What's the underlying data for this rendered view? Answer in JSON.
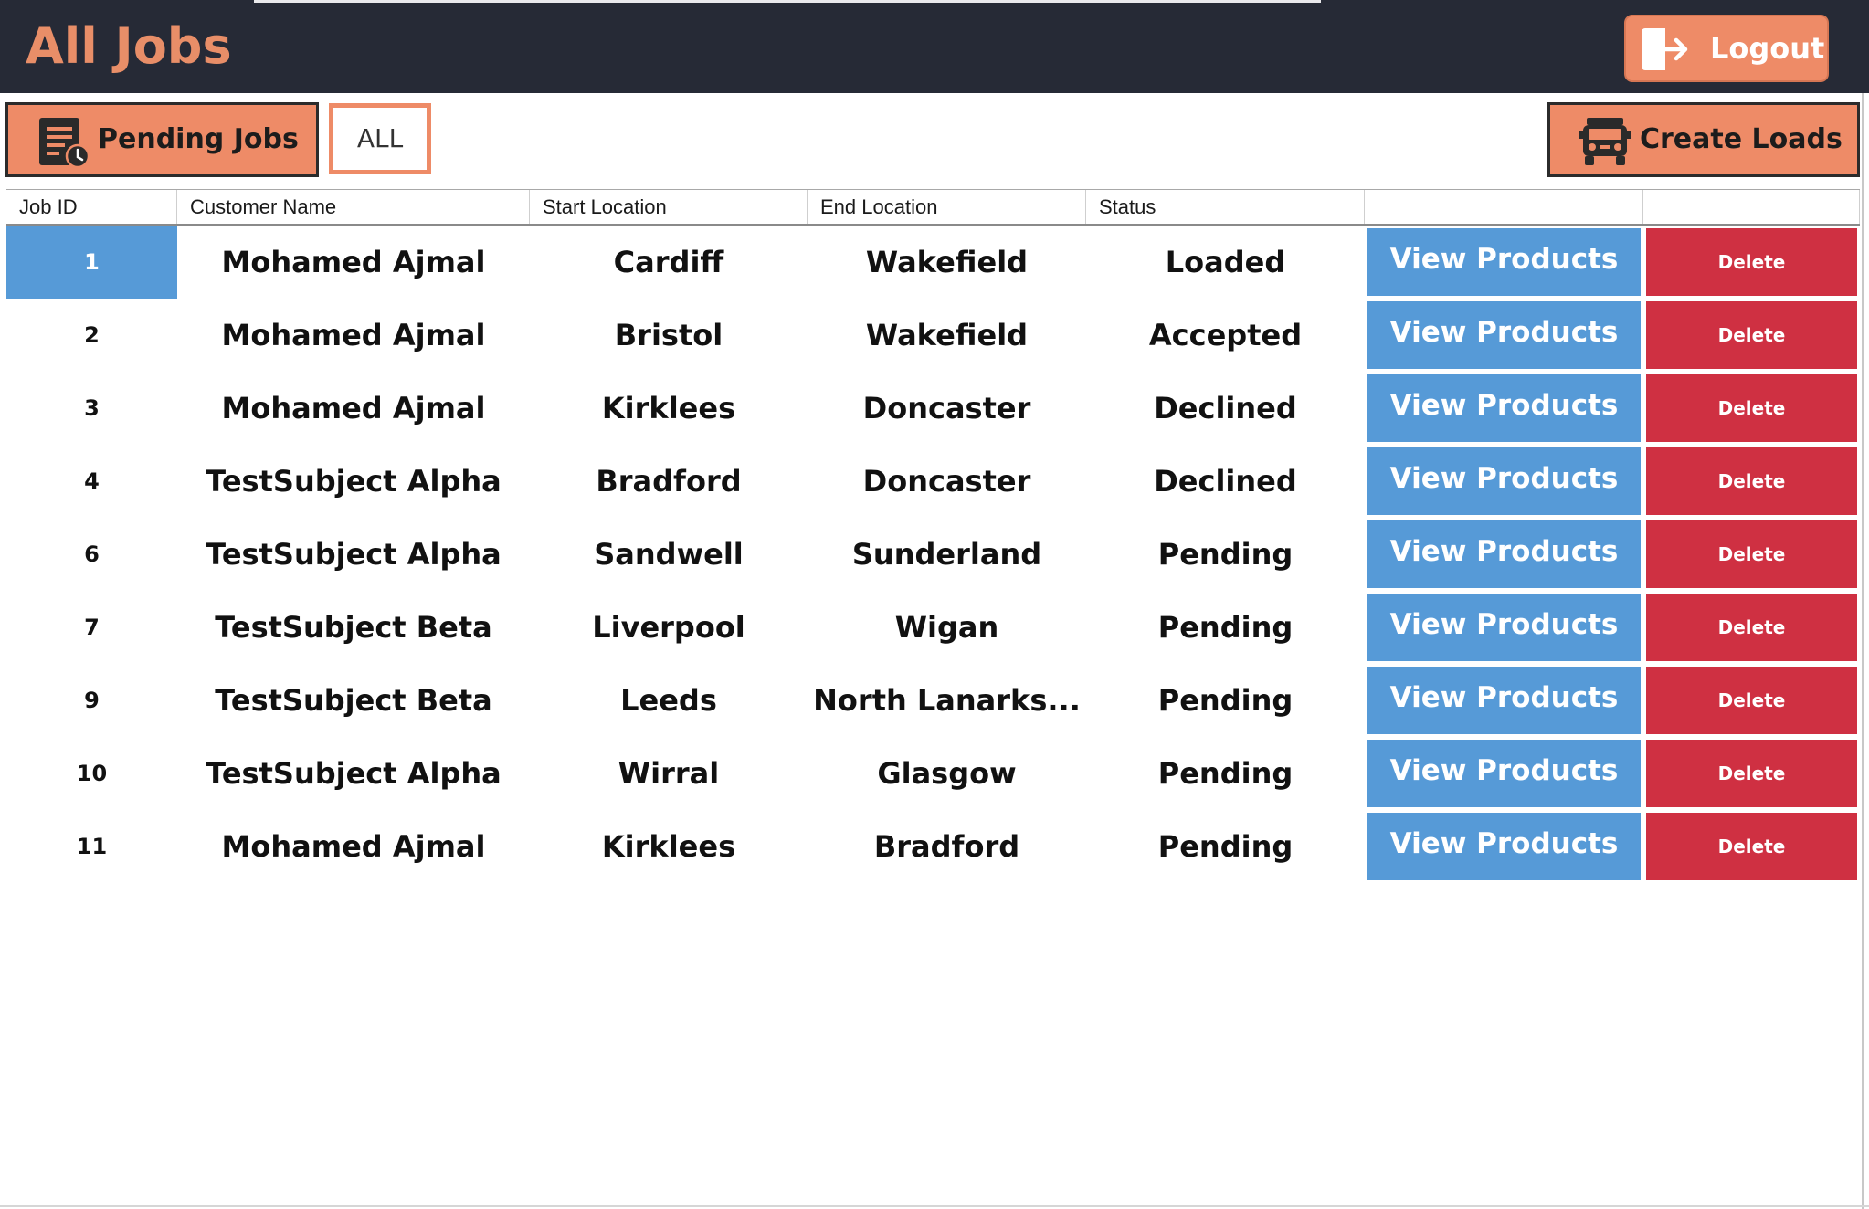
{
  "header": {
    "title": "All Jobs",
    "logout_label": "Logout",
    "logout_icon": "logout-icon",
    "background_color": "#262a36",
    "accent_color": "#ee8b67"
  },
  "toolbar": {
    "pending_label": "Pending Jobs",
    "pending_icon": "clipboard-clock-icon",
    "filter_value": "ALL",
    "create_loads_label": "Create Loads",
    "create_loads_icon": "truck-icon"
  },
  "table": {
    "columns": [
      "Job ID",
      "Customer Name",
      "Start Location",
      "End Location",
      "Status",
      "",
      ""
    ],
    "selected_row": 0,
    "view_color": "#569ad7",
    "delete_color": "#cf3042",
    "rows": [
      {
        "id": "1",
        "customer": "Mohamed Ajmal",
        "start": "Cardiff",
        "end": "Wakefield",
        "status": "Loaded",
        "view": "View Products",
        "delete": "Delete"
      },
      {
        "id": "2",
        "customer": "Mohamed Ajmal",
        "start": "Bristol",
        "end": "Wakefield",
        "status": "Accepted",
        "view": "View Products",
        "delete": "Delete"
      },
      {
        "id": "3",
        "customer": "Mohamed Ajmal",
        "start": "Kirklees",
        "end": "Doncaster",
        "status": "Declined",
        "view": "View Products",
        "delete": "Delete"
      },
      {
        "id": "4",
        "customer": "TestSubject Alpha",
        "start": "Bradford",
        "end": "Doncaster",
        "status": "Declined",
        "view": "View Products",
        "delete": "Delete"
      },
      {
        "id": "6",
        "customer": "TestSubject Alpha",
        "start": "Sandwell",
        "end": "Sunderland",
        "status": "Pending",
        "view": "View Products",
        "delete": "Delete"
      },
      {
        "id": "7",
        "customer": "TestSubject Beta",
        "start": "Liverpool",
        "end": "Wigan",
        "status": "Pending",
        "view": "View Products",
        "delete": "Delete"
      },
      {
        "id": "9",
        "customer": "TestSubject Beta",
        "start": "Leeds",
        "end": "North Lanarks...",
        "status": "Pending",
        "view": "View Products",
        "delete": "Delete"
      },
      {
        "id": "10",
        "customer": "TestSubject Alpha",
        "start": "Wirral",
        "end": "Glasgow",
        "status": "Pending",
        "view": "View Products",
        "delete": "Delete"
      },
      {
        "id": "11",
        "customer": "Mohamed Ajmal",
        "start": "Kirklees",
        "end": "Bradford",
        "status": "Pending",
        "view": "View Products",
        "delete": "Delete"
      }
    ]
  }
}
